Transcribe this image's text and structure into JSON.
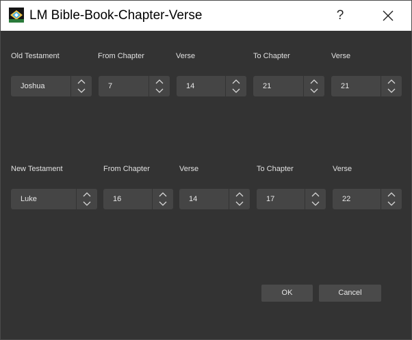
{
  "window": {
    "title": "LM Bible-Book-Chapter-Verse",
    "help_glyph": "?"
  },
  "old_testament": {
    "labels": {
      "book": "Old Testament",
      "from_chapter": "From Chapter",
      "from_verse": "Verse",
      "to_chapter": "To Chapter",
      "to_verse": "Verse"
    },
    "values": {
      "book": "Joshua",
      "from_chapter": "7",
      "from_verse": "14",
      "to_chapter": "21",
      "to_verse": "21"
    }
  },
  "new_testament": {
    "labels": {
      "book": "New Testament",
      "from_chapter": "From Chapter",
      "from_verse": "Verse",
      "to_chapter": "To Chapter",
      "to_verse": "Verse"
    },
    "values": {
      "book": "Luke",
      "from_chapter": "16",
      "from_verse": "14",
      "to_chapter": "17",
      "to_verse": "22"
    }
  },
  "buttons": {
    "ok": "OK",
    "cancel": "Cancel"
  },
  "colors": {
    "background": "#333333",
    "field": "#454545",
    "button": "#4a4a4a",
    "text": "#e0e0e0",
    "titlebar": "#ffffff"
  }
}
